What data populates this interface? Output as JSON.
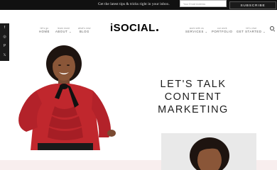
{
  "topbar": {
    "promo_text": "Get the latest tips & tricks right in your inbox.",
    "email_placeholder": "Your Email Address",
    "subscribe_label": "SUBSCRIBE"
  },
  "social": {
    "items": [
      {
        "name": "facebook",
        "glyph": "f"
      },
      {
        "name": "instagram",
        "glyph": "◎"
      },
      {
        "name": "pinterest",
        "glyph": "P"
      },
      {
        "name": "twitter",
        "glyph": "𝕏"
      }
    ]
  },
  "nav": {
    "left": [
      {
        "small": "let's go",
        "label": "HOME"
      },
      {
        "small": "learn more",
        "label": "ABOUT ⌄"
      },
      {
        "small": "what's new",
        "label": "BLOG"
      }
    ],
    "logo": "iSOCIAL",
    "right": [
      {
        "small": "work with us",
        "label": "SERVICES ⌄"
      },
      {
        "small": "our work",
        "label": "PORTFOLIO"
      },
      {
        "small": "let's chat",
        "label": "GET STARTED ⌄"
      }
    ]
  },
  "hero": {
    "title_lines": [
      "LET'S TALK",
      "CONTENT",
      "MARKETING"
    ]
  },
  "colors": {
    "topbar_bg": "#111111",
    "blouse": "#c0272d",
    "bottom_strip": "#f8eeee"
  }
}
